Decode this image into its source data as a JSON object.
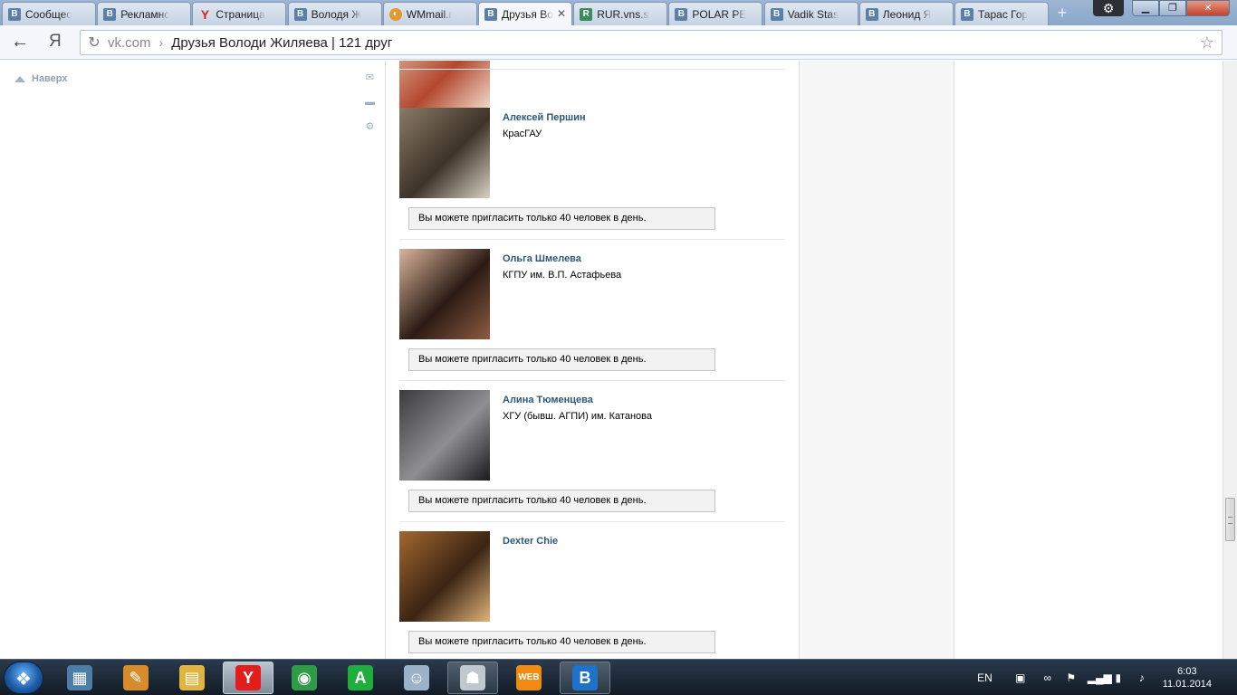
{
  "browser": {
    "tabs": [
      {
        "label": "Сообщес",
        "favicon": "vk"
      },
      {
        "label": "Рекламнс",
        "favicon": "vk"
      },
      {
        "label": "Страница",
        "favicon": "yandex"
      },
      {
        "label": "Володя Ж",
        "favicon": "vk"
      },
      {
        "label": "WMmail.r",
        "favicon": "wmmail"
      },
      {
        "label": "Друзья Во",
        "favicon": "vk",
        "active": true
      },
      {
        "label": "RUR.vns.s",
        "favicon": "rur"
      },
      {
        "label": "POLAR PE",
        "favicon": "vk"
      },
      {
        "label": "Vadik Stas",
        "favicon": "vk"
      },
      {
        "label": "Леонид Я",
        "favicon": "vk"
      },
      {
        "label": "Тарас Гор",
        "favicon": "vk"
      }
    ],
    "new_tab": "+",
    "settings_icon": "gear-icon",
    "window_controls": {
      "minimize": "▁",
      "maximize": "❐",
      "close": "✕"
    },
    "back": "←",
    "yandex_button": "Я",
    "reload": "↻",
    "address": {
      "domain": "vk.com",
      "separator": "›",
      "page_title": "Друзья Володи Жиляева | 121 друг"
    },
    "star": "☆"
  },
  "page": {
    "up_link": "Наверх",
    "side_icons": [
      "mail-icon",
      "chat-icon",
      "settings-icon"
    ],
    "friends": [
      {
        "name": "",
        "school": "",
        "avatar_colors": [
          "#e7c7b1",
          "#b3472e",
          "#f3e0d0"
        ],
        "show_invite": false
      },
      {
        "name": "Алексей Першин",
        "school": "КрасГАУ",
        "avatar_colors": [
          "#8a7a66",
          "#3d3328",
          "#d9d1c4"
        ],
        "show_invite": true
      },
      {
        "name": "Ольга Шмелева",
        "school": "КГПУ им. В.П. Астафьева",
        "avatar_colors": [
          "#d9b49a",
          "#2b1b14",
          "#8e5c43"
        ],
        "show_invite": true
      },
      {
        "name": "Алина Тюменцева",
        "school": "ХГУ (бывш. АГПИ) им. Катанова",
        "avatar_colors": [
          "#3b3a3e",
          "#8f8e93",
          "#1a191c"
        ],
        "show_invite": true
      },
      {
        "name": "Dexter Chie",
        "school": "",
        "avatar_colors": [
          "#a4672f",
          "#3a2413",
          "#e1b37a"
        ],
        "show_invite": true
      }
    ],
    "invite_text": "Вы можете пригласить только 40 человек в день."
  },
  "taskbar": {
    "apps": [
      {
        "name": "calculator",
        "glyph": "▦",
        "color": "#4c7ea8"
      },
      {
        "name": "paint",
        "glyph": "✎",
        "color": "#d88b2b"
      },
      {
        "name": "explorer",
        "glyph": "▤",
        "color": "#e0b43e"
      },
      {
        "name": "yandex-browser",
        "glyph": "Y",
        "color": "#e31d1d",
        "active": true
      },
      {
        "name": "chrome",
        "glyph": "◉",
        "color": "#2e9b47"
      },
      {
        "name": "a-app",
        "glyph": "A",
        "color": "#1fae3c"
      },
      {
        "name": "mascot-app",
        "glyph": "☺",
        "color": "#9bb2c8"
      },
      {
        "name": "robot-app",
        "glyph": "☗",
        "color": "#bfc7cf",
        "open": true
      },
      {
        "name": "websurf",
        "glyph": "WEB",
        "color": "#f08a12"
      },
      {
        "name": "vk-app",
        "glyph": "B",
        "color": "#1e73c9",
        "open": true
      }
    ],
    "lang": "EN",
    "tray_icons": [
      "websurf-icon",
      "network-link-icon",
      "flag-icon",
      "signal-icon",
      "battery-icon",
      "volume-icon"
    ],
    "time": "6:03",
    "date": "11.01.2014"
  }
}
